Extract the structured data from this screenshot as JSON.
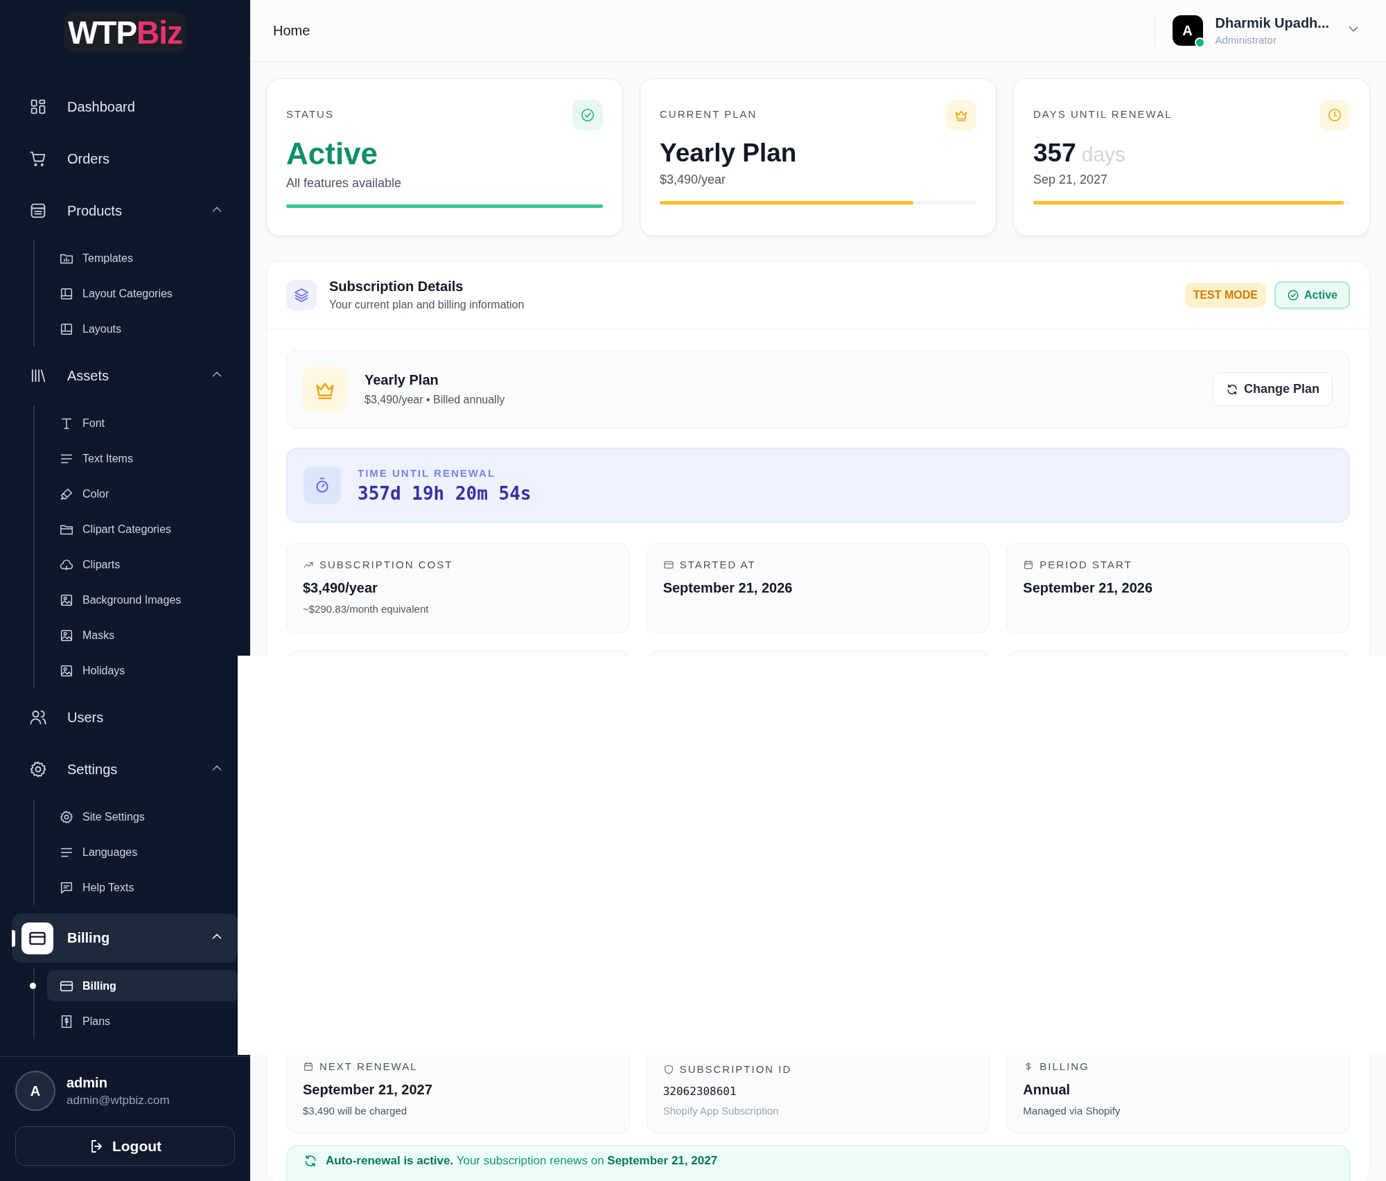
{
  "sidebar": {
    "logo": {
      "primary": "WTP",
      "accent": "Biz"
    },
    "nav": [
      {
        "label": "Dashboard",
        "selected": false
      },
      {
        "label": "Orders",
        "selected": false
      },
      {
        "label": "Products",
        "selected": false,
        "expanded": true,
        "children": [
          {
            "label": "Templates",
            "selected": false
          },
          {
            "label": "Layout Categories",
            "selected": false
          },
          {
            "label": "Layouts",
            "selected": false
          }
        ]
      },
      {
        "label": "Assets",
        "selected": false,
        "expanded": true,
        "children": [
          {
            "label": "Font",
            "selected": false
          },
          {
            "label": "Text Items",
            "selected": false
          },
          {
            "label": "Color",
            "selected": false
          },
          {
            "label": "Clipart Categories",
            "selected": false
          },
          {
            "label": "Cliparts",
            "selected": false
          },
          {
            "label": "Background Images",
            "selected": false
          },
          {
            "label": "Masks",
            "selected": false
          },
          {
            "label": "Holidays",
            "selected": false
          }
        ]
      },
      {
        "label": "Users",
        "selected": false
      },
      {
        "label": "Settings",
        "selected": false,
        "expanded": true,
        "children": [
          {
            "label": "Site Settings",
            "selected": false
          },
          {
            "label": "Languages",
            "selected": false
          },
          {
            "label": "Help Texts",
            "selected": false
          }
        ]
      },
      {
        "label": "Billing",
        "selected": true,
        "expanded": true,
        "children": [
          {
            "label": "Billing",
            "selected": true
          },
          {
            "label": "Plans",
            "selected": false
          }
        ]
      }
    ],
    "user": {
      "avatar": "A",
      "name": "admin",
      "email": "admin@wtpbiz.com"
    },
    "logout": "Logout"
  },
  "header": {
    "breadcrumb": "Home",
    "user": {
      "avatar": "A",
      "name": "Dharmik Upadh...",
      "role": "Administrator",
      "online": true
    }
  },
  "stat_cards": [
    {
      "kind": "status",
      "label": "STATUS",
      "value": "Active",
      "subtitle": "All features available",
      "level": 1
    },
    {
      "kind": "plan",
      "label": "CURRENT PLAN",
      "value": "Yearly Plan",
      "subtitle": "$3,490/year",
      "level": 0.8
    },
    {
      "kind": "renewal",
      "label": "DAYS UNTIL RENEWAL",
      "value": "357",
      "unit": "days",
      "subtitle": "Sep 21, 2027",
      "level": 0.98
    }
  ],
  "subscription": {
    "title": "Subscription Details",
    "subtitle": "Your current plan and billing information",
    "badges": [
      {
        "kind": "warning",
        "label": "TEST MODE"
      },
      {
        "kind": "success",
        "label": "Active"
      }
    ],
    "plan": {
      "name": "Yearly Plan",
      "details": "$3,490/year • Billed annually",
      "action": "Change Plan"
    },
    "countdown": {
      "label": "TIME UNTIL RENEWAL",
      "value": "357d 19h 20m 54s"
    },
    "details": [
      {
        "kind": "text",
        "label": "SUBSCRIPTION COST",
        "value": "$3,490/year",
        "note": "~$290.83/month equivalent"
      },
      {
        "kind": "text",
        "label": "STARTED AT",
        "value": "September 21, 2026"
      },
      {
        "kind": "text",
        "label": "PERIOD START",
        "value": "September 21, 2026"
      },
      {
        "kind": "text",
        "label": "NEXT RENEWAL",
        "value": "September 21, 2027",
        "note": "$3,490 will be charged"
      },
      {
        "kind": "mono",
        "label": "SUBSCRIPTION ID",
        "value": "32062308601",
        "note": "Shopify App Subscription"
      },
      {
        "kind": "text",
        "label": "BILLING",
        "value": "Annual",
        "note": "Managed via Shopify"
      }
    ],
    "notice": "**Auto-renewal is active.** Your subscription renews on **September 21, 2027**"
  }
}
